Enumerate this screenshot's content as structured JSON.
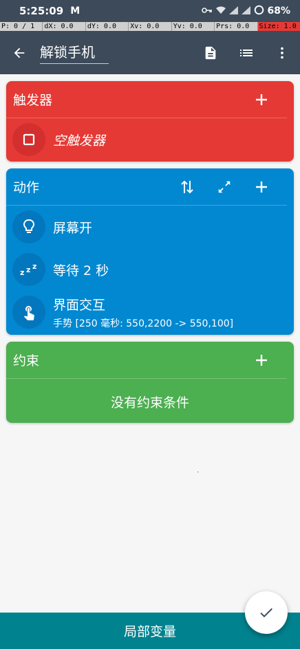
{
  "status": {
    "time": "5:25:09",
    "logo": "M",
    "battery": "68%"
  },
  "debug": [
    "P: 0 / 1",
    "dX: 0.0",
    "dY: 0.0",
    "Xv: 0.0",
    "Yv: 0.0",
    "Prs: 0.0",
    "Size: 1.0"
  ],
  "app_bar": {
    "title": "解锁手机",
    "icons": [
      "back-arrow-icon",
      "document-icon",
      "list-icon",
      "more-vert-icon"
    ]
  },
  "trigger_card": {
    "label": "触发器",
    "item": "空触发器",
    "color": "#e53935"
  },
  "action_card": {
    "label": "动作",
    "color": "#0288d1",
    "items": [
      {
        "title": "屏幕开",
        "icon": "lightbulb-icon"
      },
      {
        "title": "等待 2 秒",
        "icon": "sleep-zzz-icon"
      },
      {
        "title": "界面交互",
        "subtitle": "手势 [250 毫秒: 550,2200 -> 550,100]",
        "icon": "touch-gesture-icon"
      }
    ]
  },
  "constraint_card": {
    "label": "约束",
    "empty_text": "没有约束条件",
    "color": "#4caf50"
  },
  "bottom_bar": {
    "label": "局部变量",
    "color": "#00838f"
  }
}
